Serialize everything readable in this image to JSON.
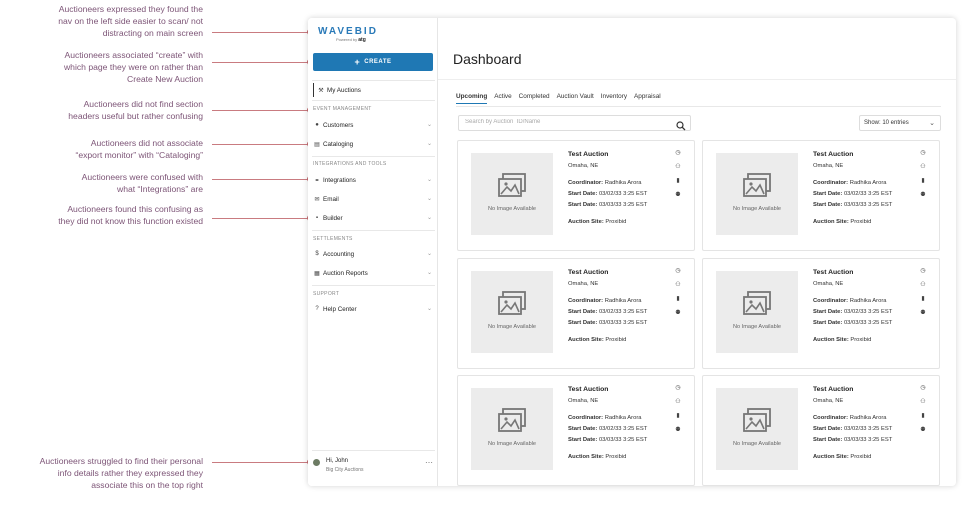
{
  "annotations": [
    "Auctioneers expressed they found the\nnav on the left side easier to scan/ not\ndistracting on main screen",
    "Auctioneers associated “create” with\nwhich page they were on rather than\nCreate New Auction",
    "Auctioneers did not find section\nheaders useful but rather confusing",
    "Auctioneers did not associate\n“export monitor” with “Cataloging”",
    "Auctioneers were confused with\nwhat “Integrations” are",
    "Auctioneers found this confusing as\nthey did not  know this function existed",
    "Auctioneers struggled to find their personal\ninfo details rather they expressed they\nassociate this on the top right"
  ],
  "colors": {
    "accent": "#1f78b4",
    "annotation_text": "#7d5577",
    "annotation_line": "#c97b80"
  },
  "sidebar": {
    "logo": "WAVEBID",
    "logo_sub": "Powered by",
    "logo_brand": "atg",
    "create_label": "CREATE",
    "my_auctions": "My Auctions",
    "sections": {
      "event_management": "EVENT MANAGEMENT",
      "integrations_tools": "INTEGRATIONS AND TOOLS",
      "settlements": "SETTLEMENTS",
      "support": "SUPPORT"
    },
    "items": {
      "customers": "Customers",
      "cataloging": "Cataloging",
      "integrations": "Integrations",
      "email": "Email",
      "builder": "Builder",
      "accounting": "Accounting",
      "auction_reports": "Auction Reports",
      "help_center": "Help Center"
    },
    "user": {
      "name": "Hi, John",
      "org": "Big City Auctions"
    }
  },
  "main": {
    "title": "Dashboard",
    "tabs": [
      "Upcoming",
      "Active",
      "Completed",
      "Auction Vault",
      "Inventory",
      "Appraisal"
    ],
    "search_placeholder": "Search by Auction  ID/Name",
    "show": "Show: 10 entries",
    "card": {
      "title": "Test Auction",
      "location": "Omaha, NE",
      "coordinator_label": "Coordinator:",
      "coordinator": "Radhika Arora",
      "start_label": "Start Date:",
      "start_a": "03/02/33 3:25 EST",
      "start_b": "03/03/33 3:25 EST",
      "site_label": "Auction Site:",
      "site": "Proxibid",
      "no_image": "No Image Available"
    }
  }
}
